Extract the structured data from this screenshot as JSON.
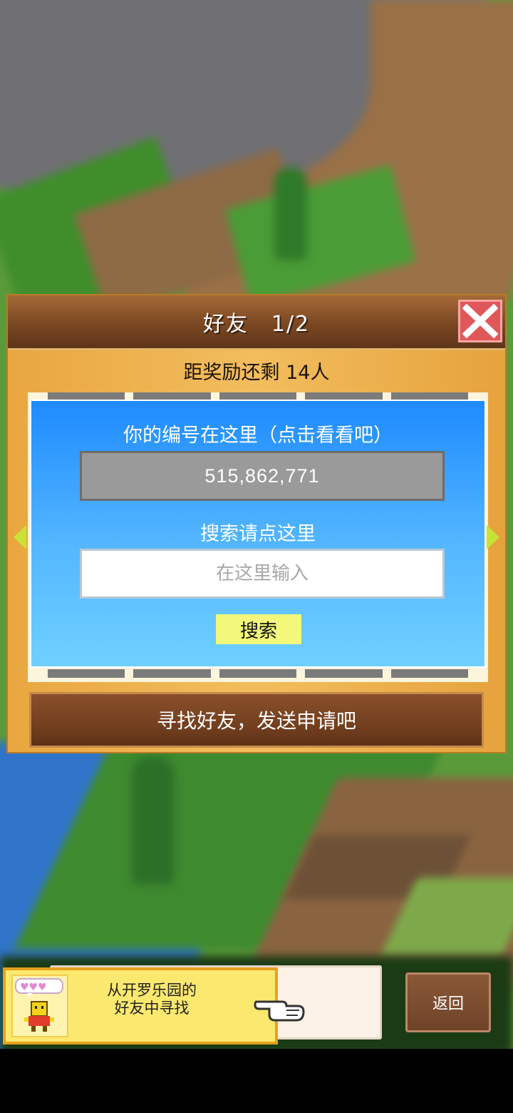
{
  "dialog": {
    "title": "好友　1/2",
    "reward_text": "距奖励还剩 14人",
    "panel": {
      "id_label": "你的编号在这里（点击看看吧）",
      "player_id": "515,862,771",
      "search_label": "搜索请点这里",
      "search_placeholder": "在这里输入",
      "search_button": "搜索"
    },
    "find_friends_button": "寻找好友，发送申请吧"
  },
  "bottom": {
    "banner_text_line1": "从开罗乐园的",
    "banner_text_line2": "好友中寻找",
    "back_button": "返回"
  },
  "icons": [
    "close-icon",
    "arrow-left-icon",
    "arrow-right-icon",
    "mascot-icon",
    "pointing-hand-icon"
  ],
  "colors": {
    "panel_blue": "#1e8bff",
    "header_brown": "#7a4722",
    "close_red": "#e0575a",
    "search_button_yellow": "#f3f87a"
  }
}
